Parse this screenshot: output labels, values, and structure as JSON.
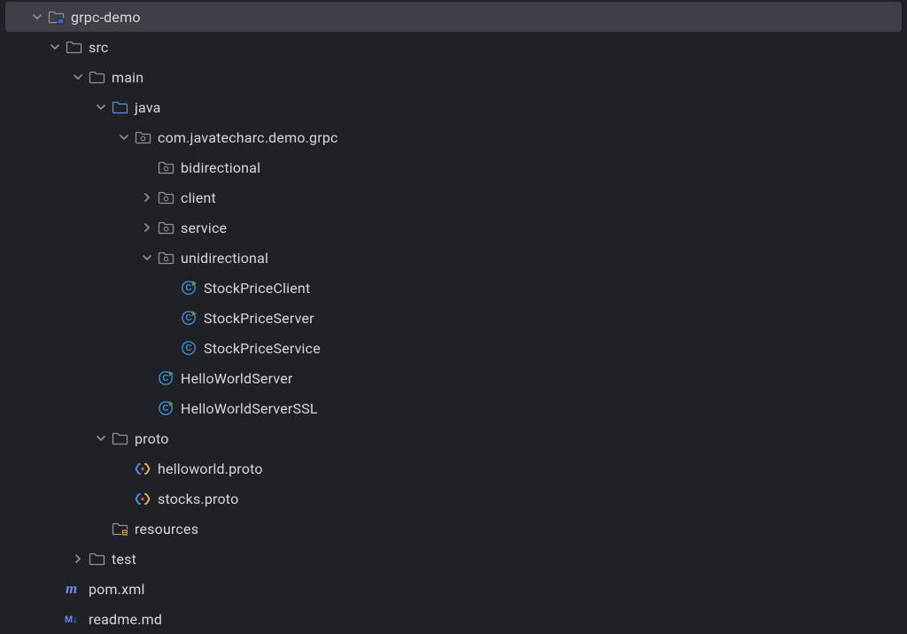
{
  "colors": {
    "blue": "#548af7",
    "green": "#57965c",
    "orange": "#d7953f",
    "muted": "#8e9296"
  },
  "tree": {
    "project": "grpc-demo",
    "src": "src",
    "main": "main",
    "java": "java",
    "pkg": "com.javatecharc.demo.grpc",
    "bidirectional": "bidirectional",
    "client": "client",
    "service": "service",
    "unidirectional": "unidirectional",
    "stockPriceClient": "StockPriceClient",
    "stockPriceServer": "StockPriceServer",
    "stockPriceService": "StockPriceService",
    "helloWorldServer": "HelloWorldServer",
    "helloWorldServerSSL": "HelloWorldServerSSL",
    "proto": "proto",
    "helloworldProto": "helloworld.proto",
    "stocksProto": "stocks.proto",
    "resources": "resources",
    "test": "test",
    "pom": "pom.xml",
    "readme": "readme.md"
  }
}
